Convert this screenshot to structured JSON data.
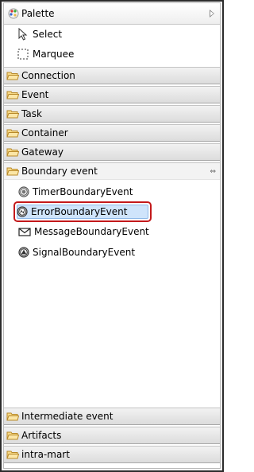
{
  "palette": {
    "title": "Palette",
    "tools": [
      {
        "label": "Select",
        "icon": "arrow-cursor-icon"
      },
      {
        "label": "Marquee",
        "icon": "marquee-icon"
      }
    ],
    "drawers_top": [
      "Connection",
      "Event",
      "Task",
      "Container",
      "Gateway"
    ],
    "open_drawer": {
      "label": "Boundary event",
      "entries": [
        {
          "label": "TimerBoundaryEvent",
          "icon": "timer-event-icon"
        },
        {
          "label": "ErrorBoundaryEvent",
          "icon": "error-event-icon",
          "selected": true
        },
        {
          "label": "MessageBoundaryEvent",
          "icon": "envelope-icon"
        },
        {
          "label": "SignalBoundaryEvent",
          "icon": "signal-event-icon"
        }
      ]
    },
    "drawers_bottom": [
      "Intermediate event",
      "Artifacts",
      "intra-mart"
    ]
  },
  "colors": {
    "selection_outline": "#c3191b",
    "selection_fill": "#cfe4fb",
    "folder": "#e9b949"
  }
}
